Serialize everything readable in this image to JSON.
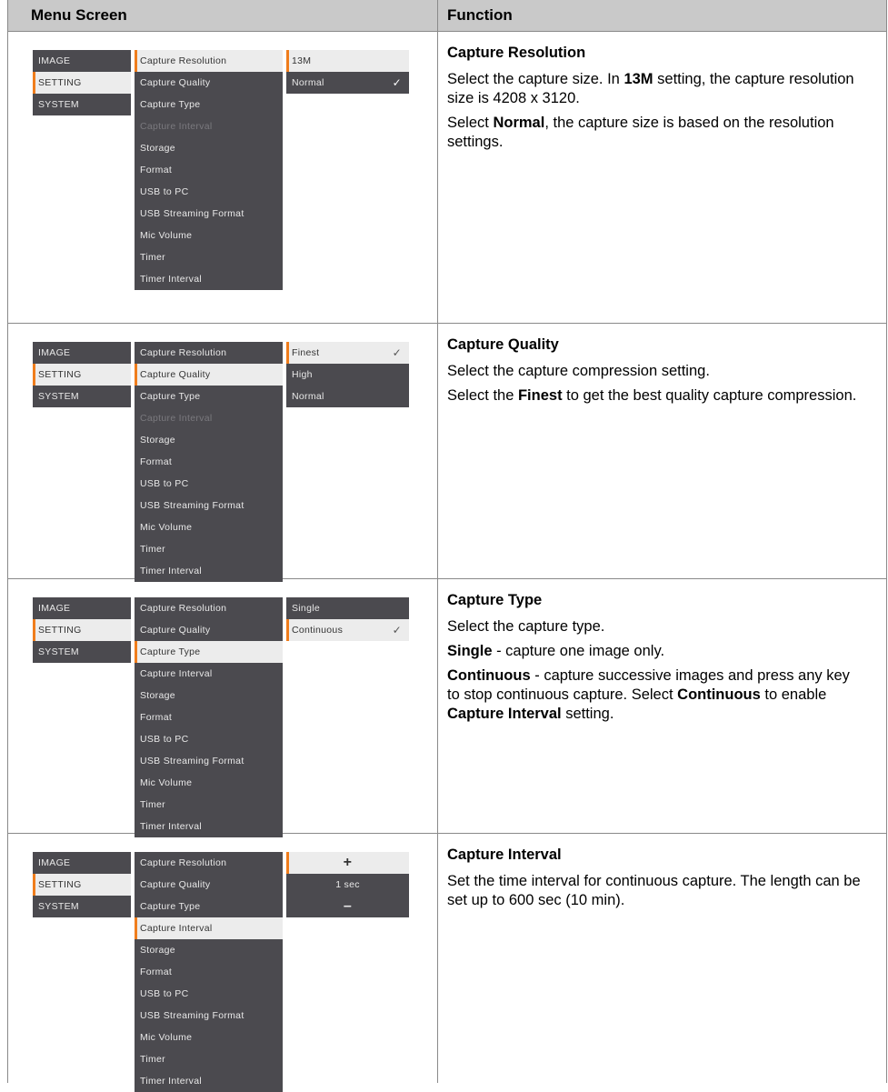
{
  "header": {
    "menu_screen": "Menu Screen",
    "function": "Function"
  },
  "menu": {
    "left": [
      "IMAGE",
      "SETTING",
      "SYSTEM"
    ],
    "middle": [
      "Capture Resolution",
      "Capture Quality",
      "Capture Type",
      "Capture Interval",
      "Storage",
      "Format",
      "USB to PC",
      "USB Streaming Format",
      "Mic Volume",
      "Timer",
      "Timer Interval"
    ]
  },
  "rows": [
    {
      "title": "Capture Resolution",
      "options": [
        "13M",
        "Normal"
      ],
      "p1": [
        "Select the capture size. In ",
        "13M",
        " setting, the capture resolution size is 4208 x 3120."
      ],
      "p2": [
        "Select ",
        "Normal",
        ", the capture size is based on the resolution settings."
      ]
    },
    {
      "title": "Capture Quality",
      "options": [
        "Finest",
        "High",
        "Normal"
      ],
      "p1": "Select the capture compression setting.",
      "p2": [
        "Select the ",
        "Finest",
        " to get the best quality capture compression."
      ]
    },
    {
      "title": "Capture Type",
      "options": [
        "Single",
        "Continuous"
      ],
      "p1": "Select the capture type.",
      "p2": [
        "Single",
        " - capture one image only."
      ],
      "p3": [
        "Continuous",
        " - capture successive images and press any key to stop continuous capture. Select ",
        "Continuous",
        " to enable ",
        "Capture Interval",
        " setting."
      ]
    },
    {
      "title": "Capture Interval",
      "options": [
        "+",
        "1 sec",
        "–"
      ],
      "p1": "Set the time interval for continuous capture. The length can be set up to 600 sec (10 min)."
    }
  ]
}
